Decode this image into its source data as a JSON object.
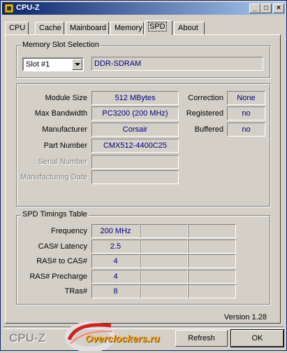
{
  "window": {
    "title": "CPU-Z",
    "min_glyph": "_",
    "max_glyph": "□",
    "close_glyph": "×"
  },
  "tabs": [
    "CPU",
    "Cache",
    "Mainboard",
    "Memory",
    "SPD",
    "About"
  ],
  "active_tab": "SPD",
  "slot_group": {
    "title": "Memory Slot Selection",
    "selected_slot": "Slot #1",
    "memory_type": "DDR-SDRAM"
  },
  "module": {
    "size_label": "Module Size",
    "size_value": "512 MBytes",
    "bandwidth_label": "Max Bandwidth",
    "bandwidth_value": "PC3200 (200 MHz)",
    "manufacturer_label": "Manufacturer",
    "manufacturer_value": "Corsair",
    "part_label": "Part Number",
    "part_value": "CMX512-4400C25",
    "serial_label": "Serial Number",
    "serial_value": "",
    "mfg_date_label": "Manufacturing Date",
    "mfg_date_value": "",
    "correction_label": "Correction",
    "correction_value": "None",
    "registered_label": "Registered",
    "registered_value": "no",
    "buffered_label": "Buffered",
    "buffered_value": "no"
  },
  "timings": {
    "title": "SPD Timings Table",
    "rows": [
      {
        "label": "Frequency",
        "values": [
          "200 MHz",
          "",
          "",
          ""
        ]
      },
      {
        "label": "CAS# Latency",
        "values": [
          "2.5",
          "",
          "",
          ""
        ]
      },
      {
        "label": "RAS# to CAS#",
        "values": [
          "4",
          "",
          "",
          ""
        ]
      },
      {
        "label": "RAS# Precharge",
        "values": [
          "4",
          "",
          "",
          ""
        ]
      },
      {
        "label": "TRas#",
        "values": [
          "8",
          "",
          "",
          ""
        ]
      }
    ]
  },
  "version": "Version 1.28",
  "brand": "CPU-Z",
  "logo_text": "Overclockers.ru",
  "buttons": {
    "refresh": "Refresh",
    "ok": "OK"
  },
  "colors": {
    "value_text": "#000080",
    "title_start": "#0a246a",
    "title_end": "#a6caf0",
    "logo": "#f5a623"
  }
}
